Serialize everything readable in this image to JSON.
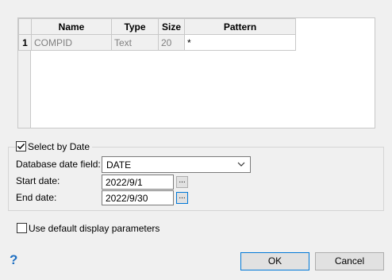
{
  "grid": {
    "columns": [
      "Name",
      "Type",
      "Size",
      "Pattern"
    ],
    "rows": [
      {
        "num": "1",
        "name": "COMPID",
        "type": "Text",
        "size": "20",
        "pattern": "*"
      }
    ]
  },
  "date_group": {
    "select_by_date_label": "Select by Date",
    "select_by_date_checked": true,
    "database_date_field_label": "Database date field:",
    "database_date_field_value": "DATE",
    "start_date_label": "Start date:",
    "start_date_value": "2022/9/1",
    "end_date_label": "End date:",
    "end_date_value": "2022/9/30",
    "browse_label": "..."
  },
  "use_default_display_label": "Use default display parameters",
  "use_default_display_checked": false,
  "buttons": {
    "ok": "OK",
    "cancel": "Cancel"
  },
  "help_icon_glyph": "?",
  "colors": {
    "accent": "#0078d7",
    "help": "#1e6fc2"
  }
}
